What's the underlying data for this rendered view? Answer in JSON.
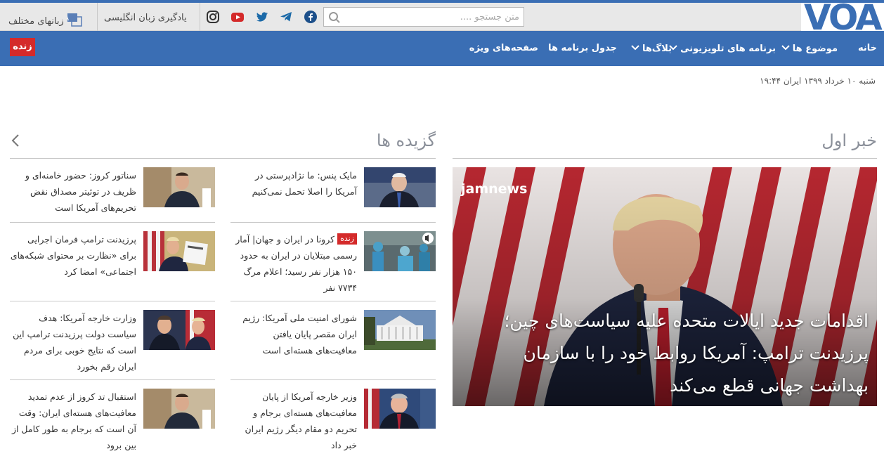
{
  "header": {
    "logo_text": "VOA",
    "search_placeholder": "متن جستجو ....",
    "english_label": "یادگیری زبان انگلیسی",
    "languages_label": "زبانهای مختلف",
    "social_icons": [
      "facebook-icon",
      "telegram-icon",
      "twitter-icon",
      "youtube-icon",
      "instagram-icon"
    ]
  },
  "nav": {
    "live_label": "زنده",
    "items": [
      "خانه",
      "موضوع ها",
      "برنامه های تلویزیونی",
      "بلاگ‌ها",
      "جدول برنامه ها",
      "صفحه‌های ویژه"
    ]
  },
  "date_line": "شنبه ۱۰ خرداد ۱۳۹۹ ایران ۱۹:۴۴",
  "featured": {
    "section_title": "خبر اول",
    "overlay_tag": "jamnews",
    "headline": "اقدامات جدید ایالات متحده علیه سیاست‌های چین؛ پرزیدنت ترامپ: آمریکا روابط خود را با سازمان بهداشت جهانی قطع می‌کند"
  },
  "picks": {
    "section_title": "گزیده ها",
    "items": [
      {
        "text": "مایک پنس: ما نژادپرستی در آمریکا را اصلا تحمل نمی‌کنیم",
        "live": ""
      },
      {
        "text": "سناتور کروز: حضور خامنه‌ای و ظریف در توئیتر مصداق نقض تحریم‌های آمریکا است",
        "live": ""
      },
      {
        "text": "کرونا در ایران و جهان| آمار رسمی مبتلایان در ایران به حدود ۱۵۰ هزار نفر رسید؛ اعلام مرگ ۷۷۳۴ نفر",
        "live": "زنده"
      },
      {
        "text": "پرزیدنت ترامپ فرمان اجرایی برای «نظارت بر محتوای شبکه‌های اجتماعی» امضا کرد",
        "live": ""
      },
      {
        "text": "شورای امنیت ملی آمریکا: رژیم ایران مقصر پایان یافتن معافیت‌های هسته‌ای است",
        "live": ""
      },
      {
        "text": "وزارت خارجه آمریکا: هدف سیاست دولت پرزیدنت ترامپ این است که نتایج خوبی برای مردم ایران رقم بخورد",
        "live": ""
      },
      {
        "text": "وزیر خارجه آمریکا از پایان معافیت‌های هسته‌ای برجام و تحریم دو مقام دیگر رژیم ایران خبر داد",
        "live": ""
      },
      {
        "text": "استقبال تد کروز از عدم تمدید معافیت‌های هسته‌ای ایران: وقت آن است که برجام به طور کامل از بین برود",
        "live": ""
      }
    ]
  },
  "colors": {
    "brand_blue": "#3a6eb4",
    "live_red": "#d42a2a",
    "section_gray": "#8a8f99"
  }
}
